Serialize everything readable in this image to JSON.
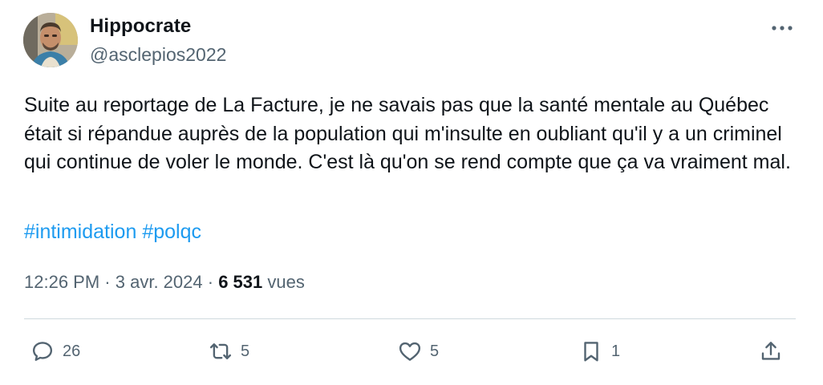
{
  "author": {
    "display_name": "Hippocrate",
    "handle": "@asclepios2022"
  },
  "tweet": {
    "text": "Suite au reportage de La Facture, je ne savais pas que la santé mentale au Québec était si répandue auprès de la population qui m'insulte en oubliant qu'il y a un criminel qui continue de voler le monde. C'est là qu'on se rend compte que ça va vraiment mal.",
    "hashtags": [
      "#intimidation",
      "#polqc"
    ],
    "time": "12:26 PM",
    "separator": "·",
    "date": "3 avr. 2024",
    "views_count": "6 531",
    "views_label": "vues"
  },
  "actions": {
    "replies": "26",
    "retweets": "5",
    "likes": "5",
    "bookmarks": "1"
  },
  "icons": {
    "more": "more-horizontal-icon",
    "reply": "reply-bubble-icon",
    "retweet": "retweet-icon",
    "like": "heart-icon",
    "bookmark": "bookmark-icon",
    "share": "share-upload-icon"
  },
  "colors": {
    "text": "#0f1419",
    "secondary": "#536471",
    "link": "#1d9bf0",
    "divider": "#cfd9de"
  }
}
